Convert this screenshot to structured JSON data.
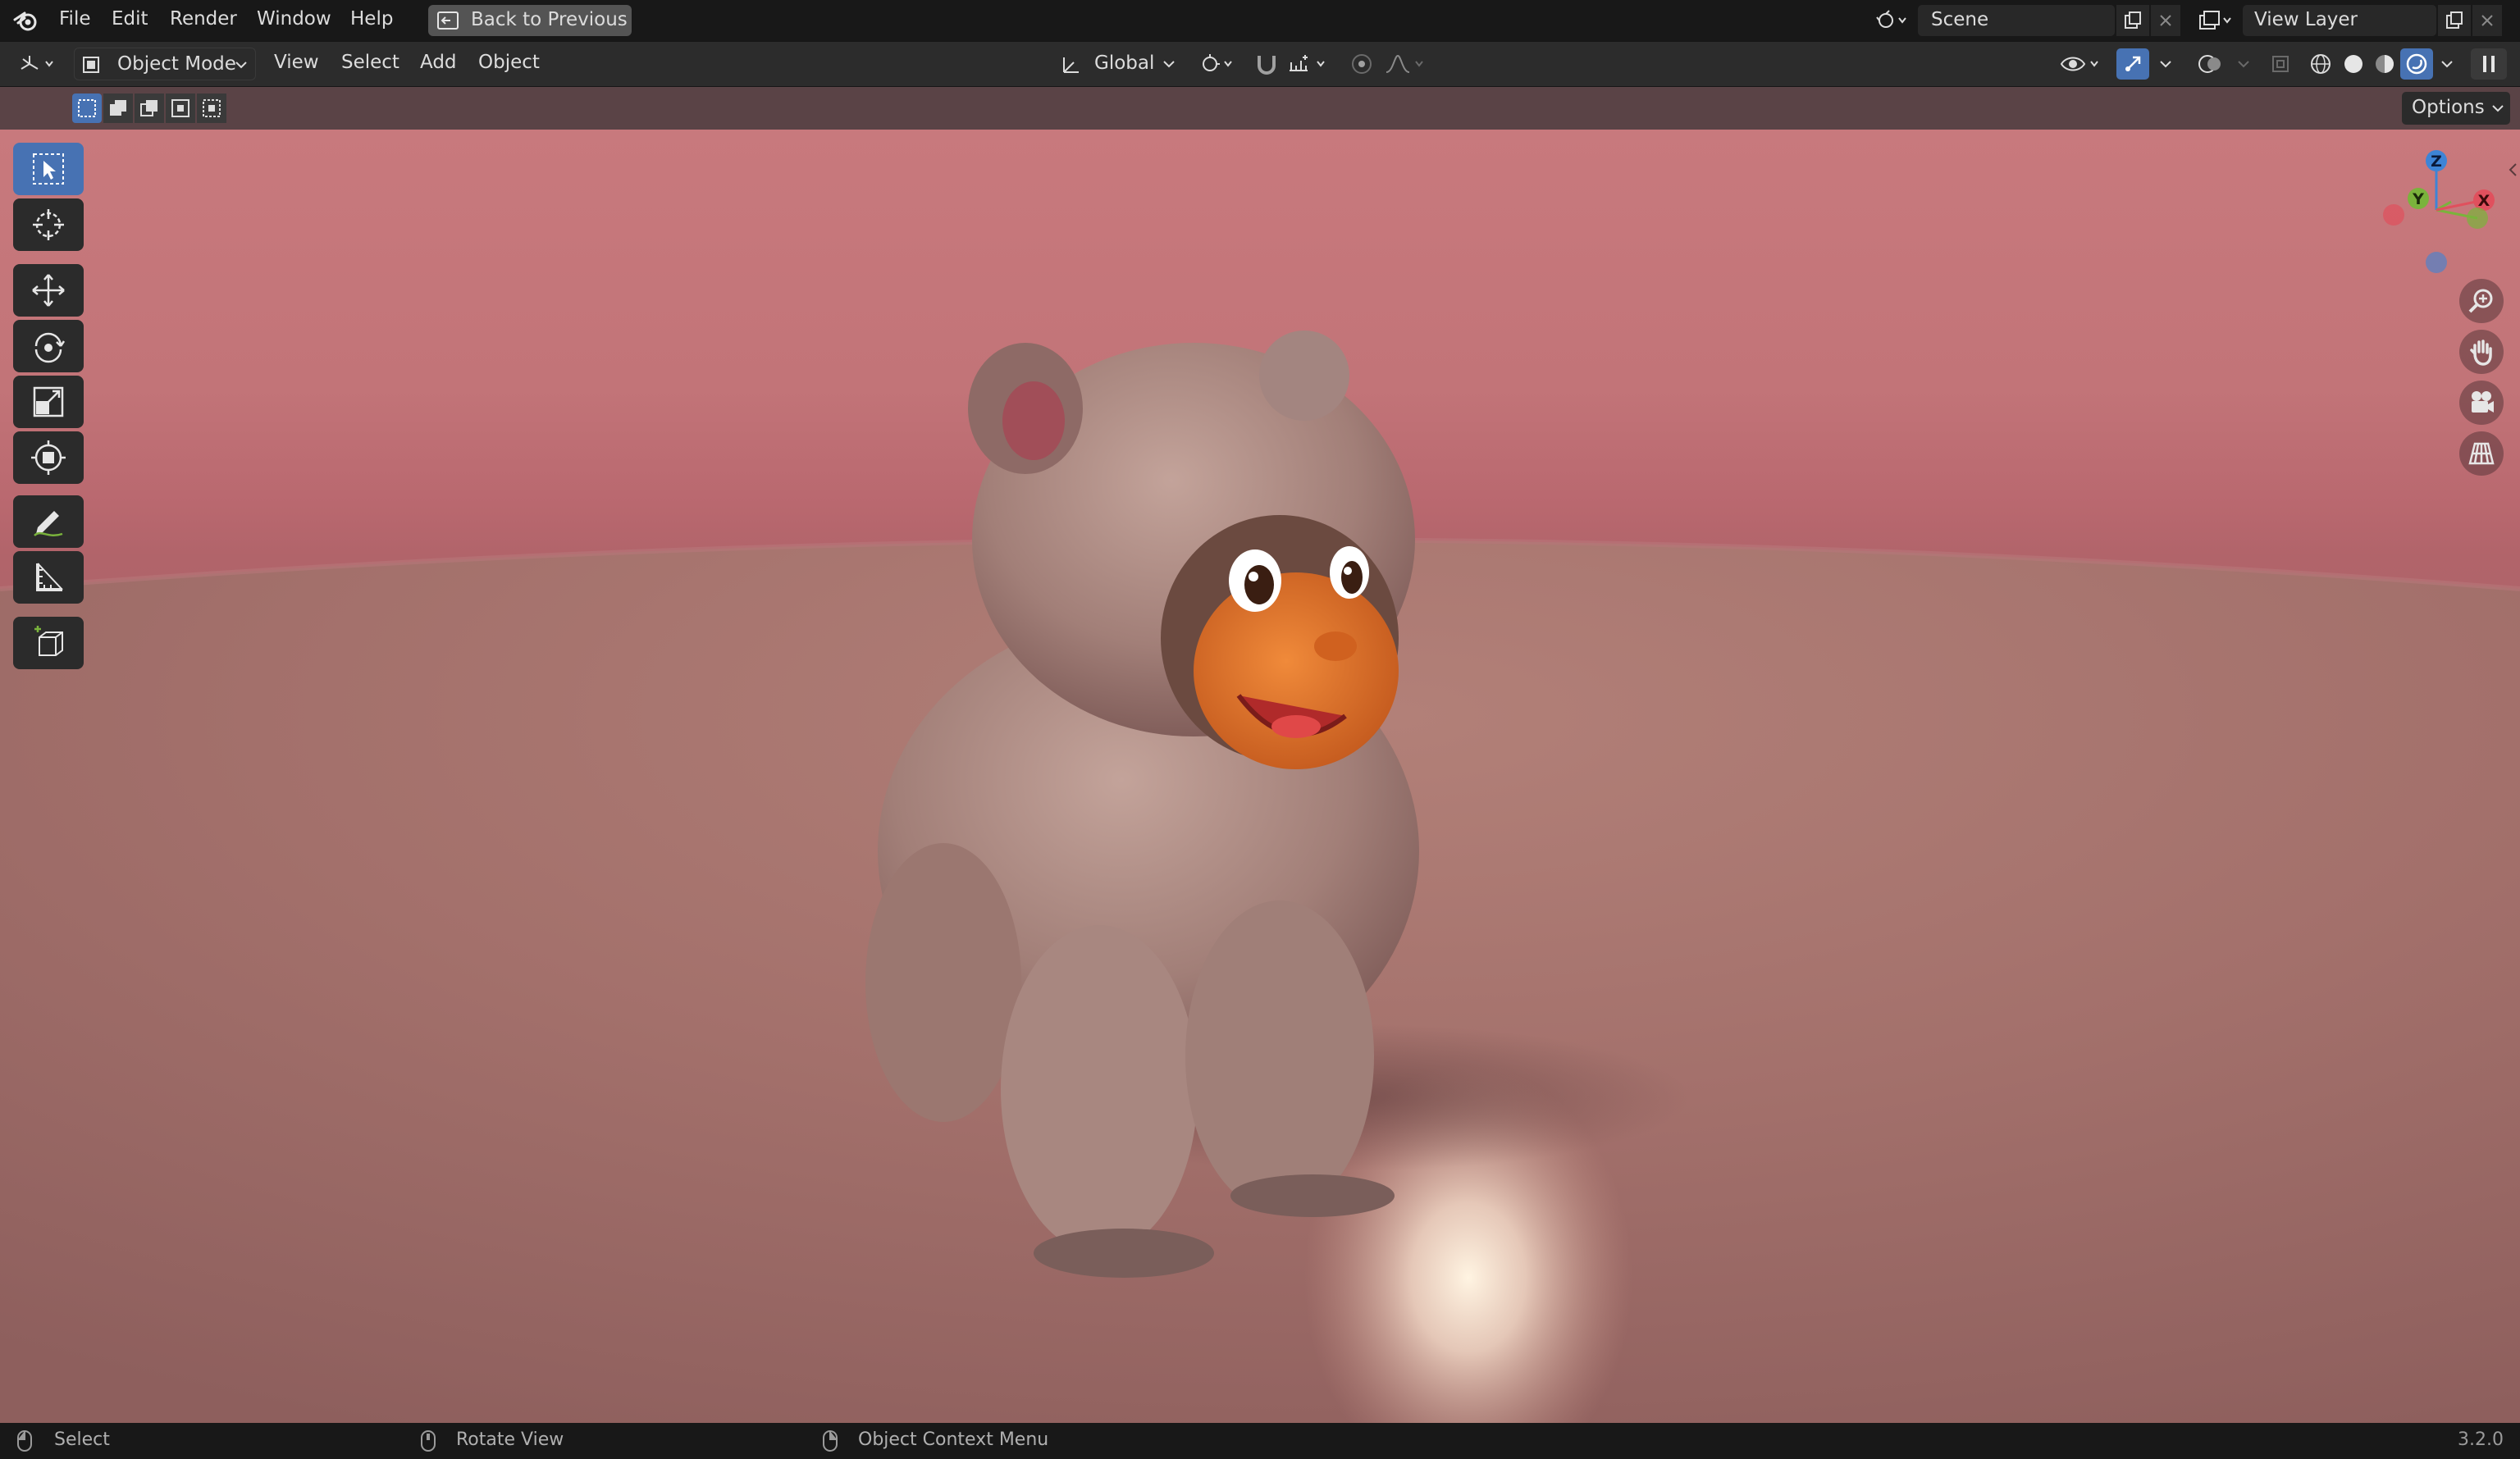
{
  "menubar": {
    "items": [
      "File",
      "Edit",
      "Render",
      "Window",
      "Help"
    ],
    "back_button": "Back to Previous",
    "scene_label": "Scene",
    "view_layer_label": "View Layer"
  },
  "header": {
    "mode": "Object Mode",
    "menus": [
      "View",
      "Select",
      "Add",
      "Object"
    ],
    "orientation": "Global",
    "options_label": "Options"
  },
  "toolbar_tools": [
    "select-box",
    "cursor",
    "move",
    "rotate",
    "scale",
    "transform",
    "annotate",
    "measure",
    "add-cube"
  ],
  "gizmo": {
    "z": "Z",
    "y": "Y",
    "x": "X"
  },
  "statusbar": {
    "select": "Select",
    "rotate": "Rotate View",
    "context": "Object Context Menu",
    "version": "3.2.0"
  },
  "colors": {
    "accent": "#4772b3",
    "x_axis": "#e0505d",
    "y_axis": "#7ab33c",
    "z_axis": "#3d84d6"
  }
}
